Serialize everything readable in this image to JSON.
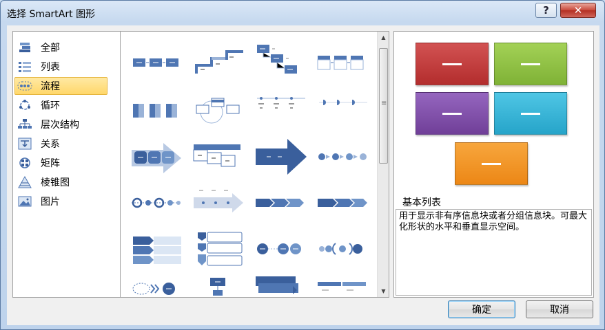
{
  "window": {
    "title": "选择 SmartArt 图形",
    "help_glyph": "?",
    "close_glyph": "✕"
  },
  "categories": [
    {
      "label": "全部",
      "icon": "all-icon",
      "selected": false
    },
    {
      "label": "列表",
      "icon": "list-icon",
      "selected": false
    },
    {
      "label": "流程",
      "icon": "process-icon",
      "selected": true
    },
    {
      "label": "循环",
      "icon": "cycle-icon",
      "selected": false
    },
    {
      "label": "层次结构",
      "icon": "hierarchy-icon",
      "selected": false
    },
    {
      "label": "关系",
      "icon": "relationship-icon",
      "selected": false
    },
    {
      "label": "矩阵",
      "icon": "matrix-icon",
      "selected": false
    },
    {
      "label": "棱锥图",
      "icon": "pyramid-icon",
      "selected": false
    },
    {
      "label": "图片",
      "icon": "picture-icon",
      "selected": false
    }
  ],
  "preview": {
    "title": "基本列表",
    "description": "用于显示非有序信息块或者分组信息块。可最大化形状的水平和垂直显示空间。",
    "colors": [
      "#c0363a",
      "#8cc43c",
      "#7e4ea3",
      "#33b5d8",
      "#f0931f"
    ]
  },
  "buttons": {
    "ok": "确定",
    "cancel": "取消"
  },
  "scrollbar": {
    "up": "▲",
    "down": "▼",
    "grip": "≡"
  }
}
